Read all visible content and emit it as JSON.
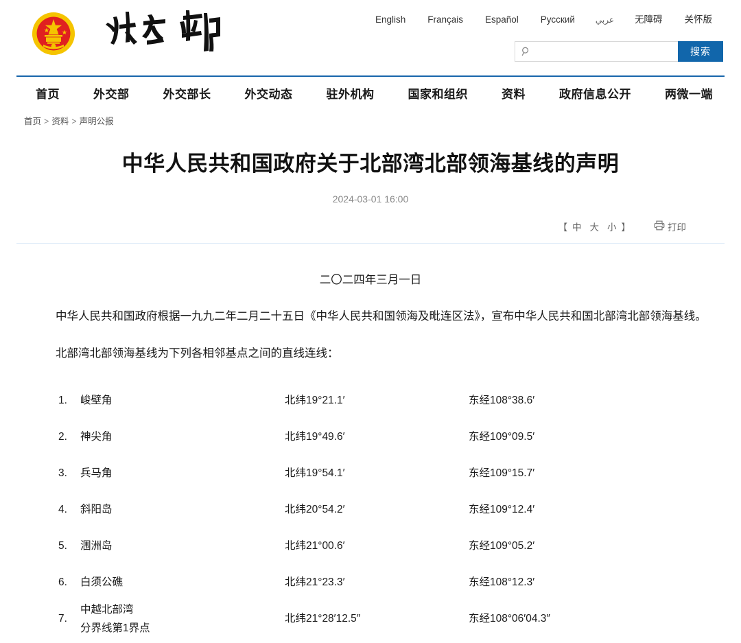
{
  "site": {
    "emblem_icon": "china-national-emblem",
    "wordmark_alt": "外交部",
    "languages": [
      {
        "label": "English",
        "name": "lang-english"
      },
      {
        "label": "Français",
        "name": "lang-francais"
      },
      {
        "label": "Español",
        "name": "lang-espanol"
      },
      {
        "label": "Русский",
        "name": "lang-russian"
      },
      {
        "label": "عربي",
        "name": "lang-arabic"
      },
      {
        "label": "无障碍",
        "name": "lang-accessibility"
      },
      {
        "label": "关怀版",
        "name": "lang-care-version"
      }
    ],
    "search": {
      "placeholder": "",
      "value": "",
      "button_label": "搜索",
      "icon": "search-icon"
    },
    "accent_color": "#1166ab",
    "nav_border_color": "#1766ab"
  },
  "nav": {
    "items": [
      {
        "label": "首页",
        "name": "nav-home"
      },
      {
        "label": "外交部",
        "name": "nav-ministry"
      },
      {
        "label": "外交部长",
        "name": "nav-minister"
      },
      {
        "label": "外交动态",
        "name": "nav-news"
      },
      {
        "label": "驻外机构",
        "name": "nav-missions"
      },
      {
        "label": "国家和组织",
        "name": "nav-countries"
      },
      {
        "label": "资料",
        "name": "nav-resources"
      },
      {
        "label": "政府信息公开",
        "name": "nav-gov-info"
      },
      {
        "label": "两微一端",
        "name": "nav-social"
      }
    ]
  },
  "breadcrumb": {
    "items": [
      "首页",
      "资料",
      "声明公报"
    ],
    "separator": ">"
  },
  "article": {
    "title": "中华人民共和国政府关于北部湾北部领海基线的声明",
    "date": "2024-03-01 16:00",
    "tools": {
      "bracket_open": "【",
      "bracket_close": "】",
      "sizes": [
        "中",
        "大",
        "小"
      ],
      "print_label": "打印",
      "print_icon": "printer-icon"
    },
    "signed_date": "二〇二四年三月一日",
    "paragraphs": [
      "中华人民共和国政府根据一九九二年二月二十五日《中华人民共和国领海及毗连区法》，宣布中华人民共和国北部湾北部领海基线。",
      "北部湾北部领海基线为下列各相邻基点之间的直线连线："
    ],
    "points": [
      {
        "index": "1.",
        "name_lines": [
          "峻壁角"
        ],
        "lat": "北纬19°21.1′",
        "lon": "东经108°38.6′"
      },
      {
        "index": "2.",
        "name_lines": [
          "神尖角"
        ],
        "lat": "北纬19°49.6′",
        "lon": "东经109°09.5′"
      },
      {
        "index": "3.",
        "name_lines": [
          "兵马角"
        ],
        "lat": "北纬19°54.1′",
        "lon": "东经109°15.7′"
      },
      {
        "index": "4.",
        "name_lines": [
          "斜阳岛"
        ],
        "lat": "北纬20°54.2′",
        "lon": "东经109°12.4′"
      },
      {
        "index": "5.",
        "name_lines": [
          "涠洲岛"
        ],
        "lat": "北纬21°00.6′",
        "lon": "东经109°05.2′"
      },
      {
        "index": "6.",
        "name_lines": [
          "白须公礁"
        ],
        "lat": "北纬21°23.3′",
        "lon": "东经108°12.3′"
      },
      {
        "index": "7.",
        "name_lines": [
          "中越北部湾",
          "分界线第1界点"
        ],
        "lat": "北纬21°28′12.5″",
        "lon": "东经108°06′04.3″"
      }
    ]
  }
}
